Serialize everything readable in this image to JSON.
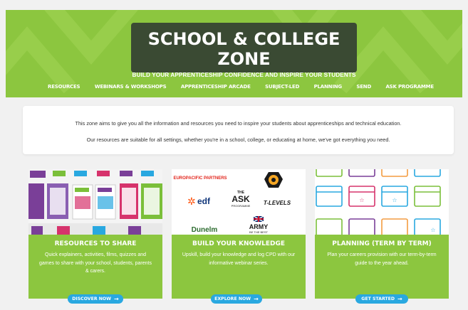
{
  "hero": {
    "title": "SCHOOL & COLLEGE ZONE",
    "subtitle": "BUILD YOUR APPRENTICESHIP CONFIDENCE AND INSPIRE YOUR STUDENTS"
  },
  "nav": {
    "items": [
      {
        "label": "RESOURCES"
      },
      {
        "label": "WEBINARS & WORKSHOPS"
      },
      {
        "label": "APPRENTICESHIP ARCADE"
      },
      {
        "label": "SUBJECT-LED"
      },
      {
        "label": "PLANNING"
      },
      {
        "label": "SEND"
      },
      {
        "label": "ASK PROGRAMME"
      }
    ]
  },
  "intro": {
    "line1": "This zone aims to give you all the information and resources you need to inspire your students about apprenticeships and technical education.",
    "line2": "Our resources are suitable for all settings, whether you're in a school, college, or educating at home, we've got everything you need."
  },
  "cards": [
    {
      "title": "RESOURCES TO SHARE",
      "desc": "Quick explainers, activities, films, quizzes and games to share with your school, students, parents & carers.",
      "button": "DISCOVER NOW",
      "icon": "arrow-right-icon"
    },
    {
      "title": "BUILD YOUR KNOWLEDGE",
      "desc": "Upskill, build your knowledge and log CPD with our informative webinar series.",
      "button": "EXPLORE NOW",
      "icon": "arrow-right-icon",
      "logos": {
        "partner": "EUROPACIFIC PARTNERS",
        "edf": "edf",
        "ask": "ASK",
        "ask_the": "THE",
        "ask_sub": "PROGRAMME",
        "tlevels": "T-LEVELS",
        "dunelm": "Dunelm",
        "army": "ARMY",
        "army_sub": "BE THE BEST"
      }
    },
    {
      "title": "PLANNING (TERM BY TERM)",
      "desc": "Plan your careers provision with our term-by-term guide to the year ahead.",
      "button": "GET STARTED",
      "icon": "arrow-right-icon"
    }
  ],
  "colors": {
    "green": "#8cc63f",
    "dark_box": "#3a4a33",
    "button_blue": "#29a8e0"
  }
}
